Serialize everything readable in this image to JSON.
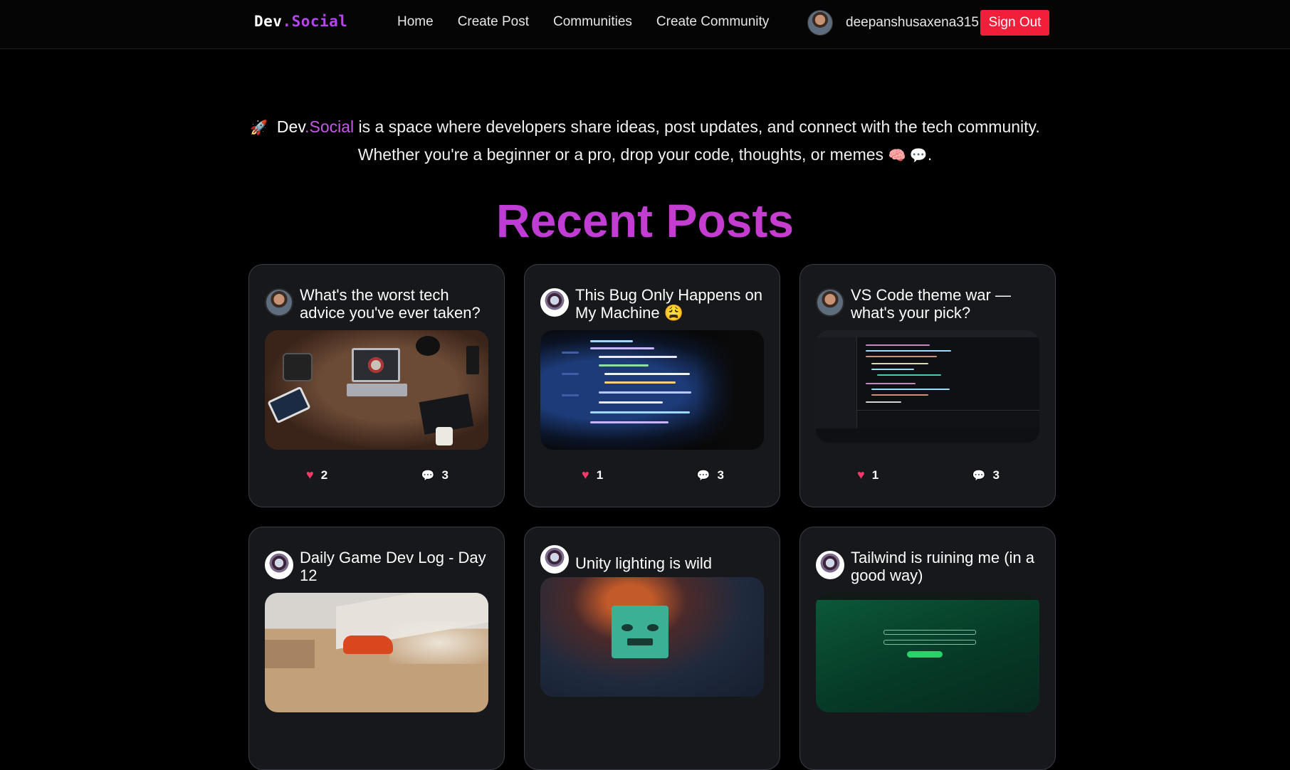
{
  "nav": {
    "logo_part1": "Dev",
    "logo_part2": ".Social",
    "links": [
      "Home",
      "Create Post",
      "Communities",
      "Create Community"
    ],
    "username": "deepanshusaxena315",
    "signout_label": "Sign Out"
  },
  "intro": {
    "rocket_emoji": "🚀",
    "brand_part1": "Dev",
    "brand_part2": ".Social",
    "line1_rest": " is a space where developers share ideas, post updates, and connect with the tech community.",
    "line2": "Whether you're a beginner or a pro, drop your code, thoughts, or memes",
    "line2_emojis": "🧠 💬",
    "line2_end": "."
  },
  "heading": "Recent Posts",
  "colors": {
    "accent": "#b445f0",
    "heading": "#c13ad9",
    "signout": "#f11f3a",
    "heart": "#f43a6b",
    "card_bg": "#17181c"
  },
  "posts": [
    {
      "title": "What's the worst tech advice you've ever taken?",
      "likes": "2",
      "comments": "3"
    },
    {
      "title": "This Bug Only Happens on My Machine 😩",
      "likes": "1",
      "comments": "3"
    },
    {
      "title": "VS Code theme war — what's your pick?",
      "likes": "1",
      "comments": "3"
    },
    {
      "title": "Daily Game Dev Log - Day 12",
      "likes": "",
      "comments": ""
    },
    {
      "title": "Unity lighting is wild",
      "likes": "",
      "comments": ""
    },
    {
      "title": "Tailwind is ruining me (in a good way)",
      "likes": "",
      "comments": ""
    }
  ],
  "icons": {
    "heart": "heart-icon",
    "comment": "comment-icon"
  }
}
